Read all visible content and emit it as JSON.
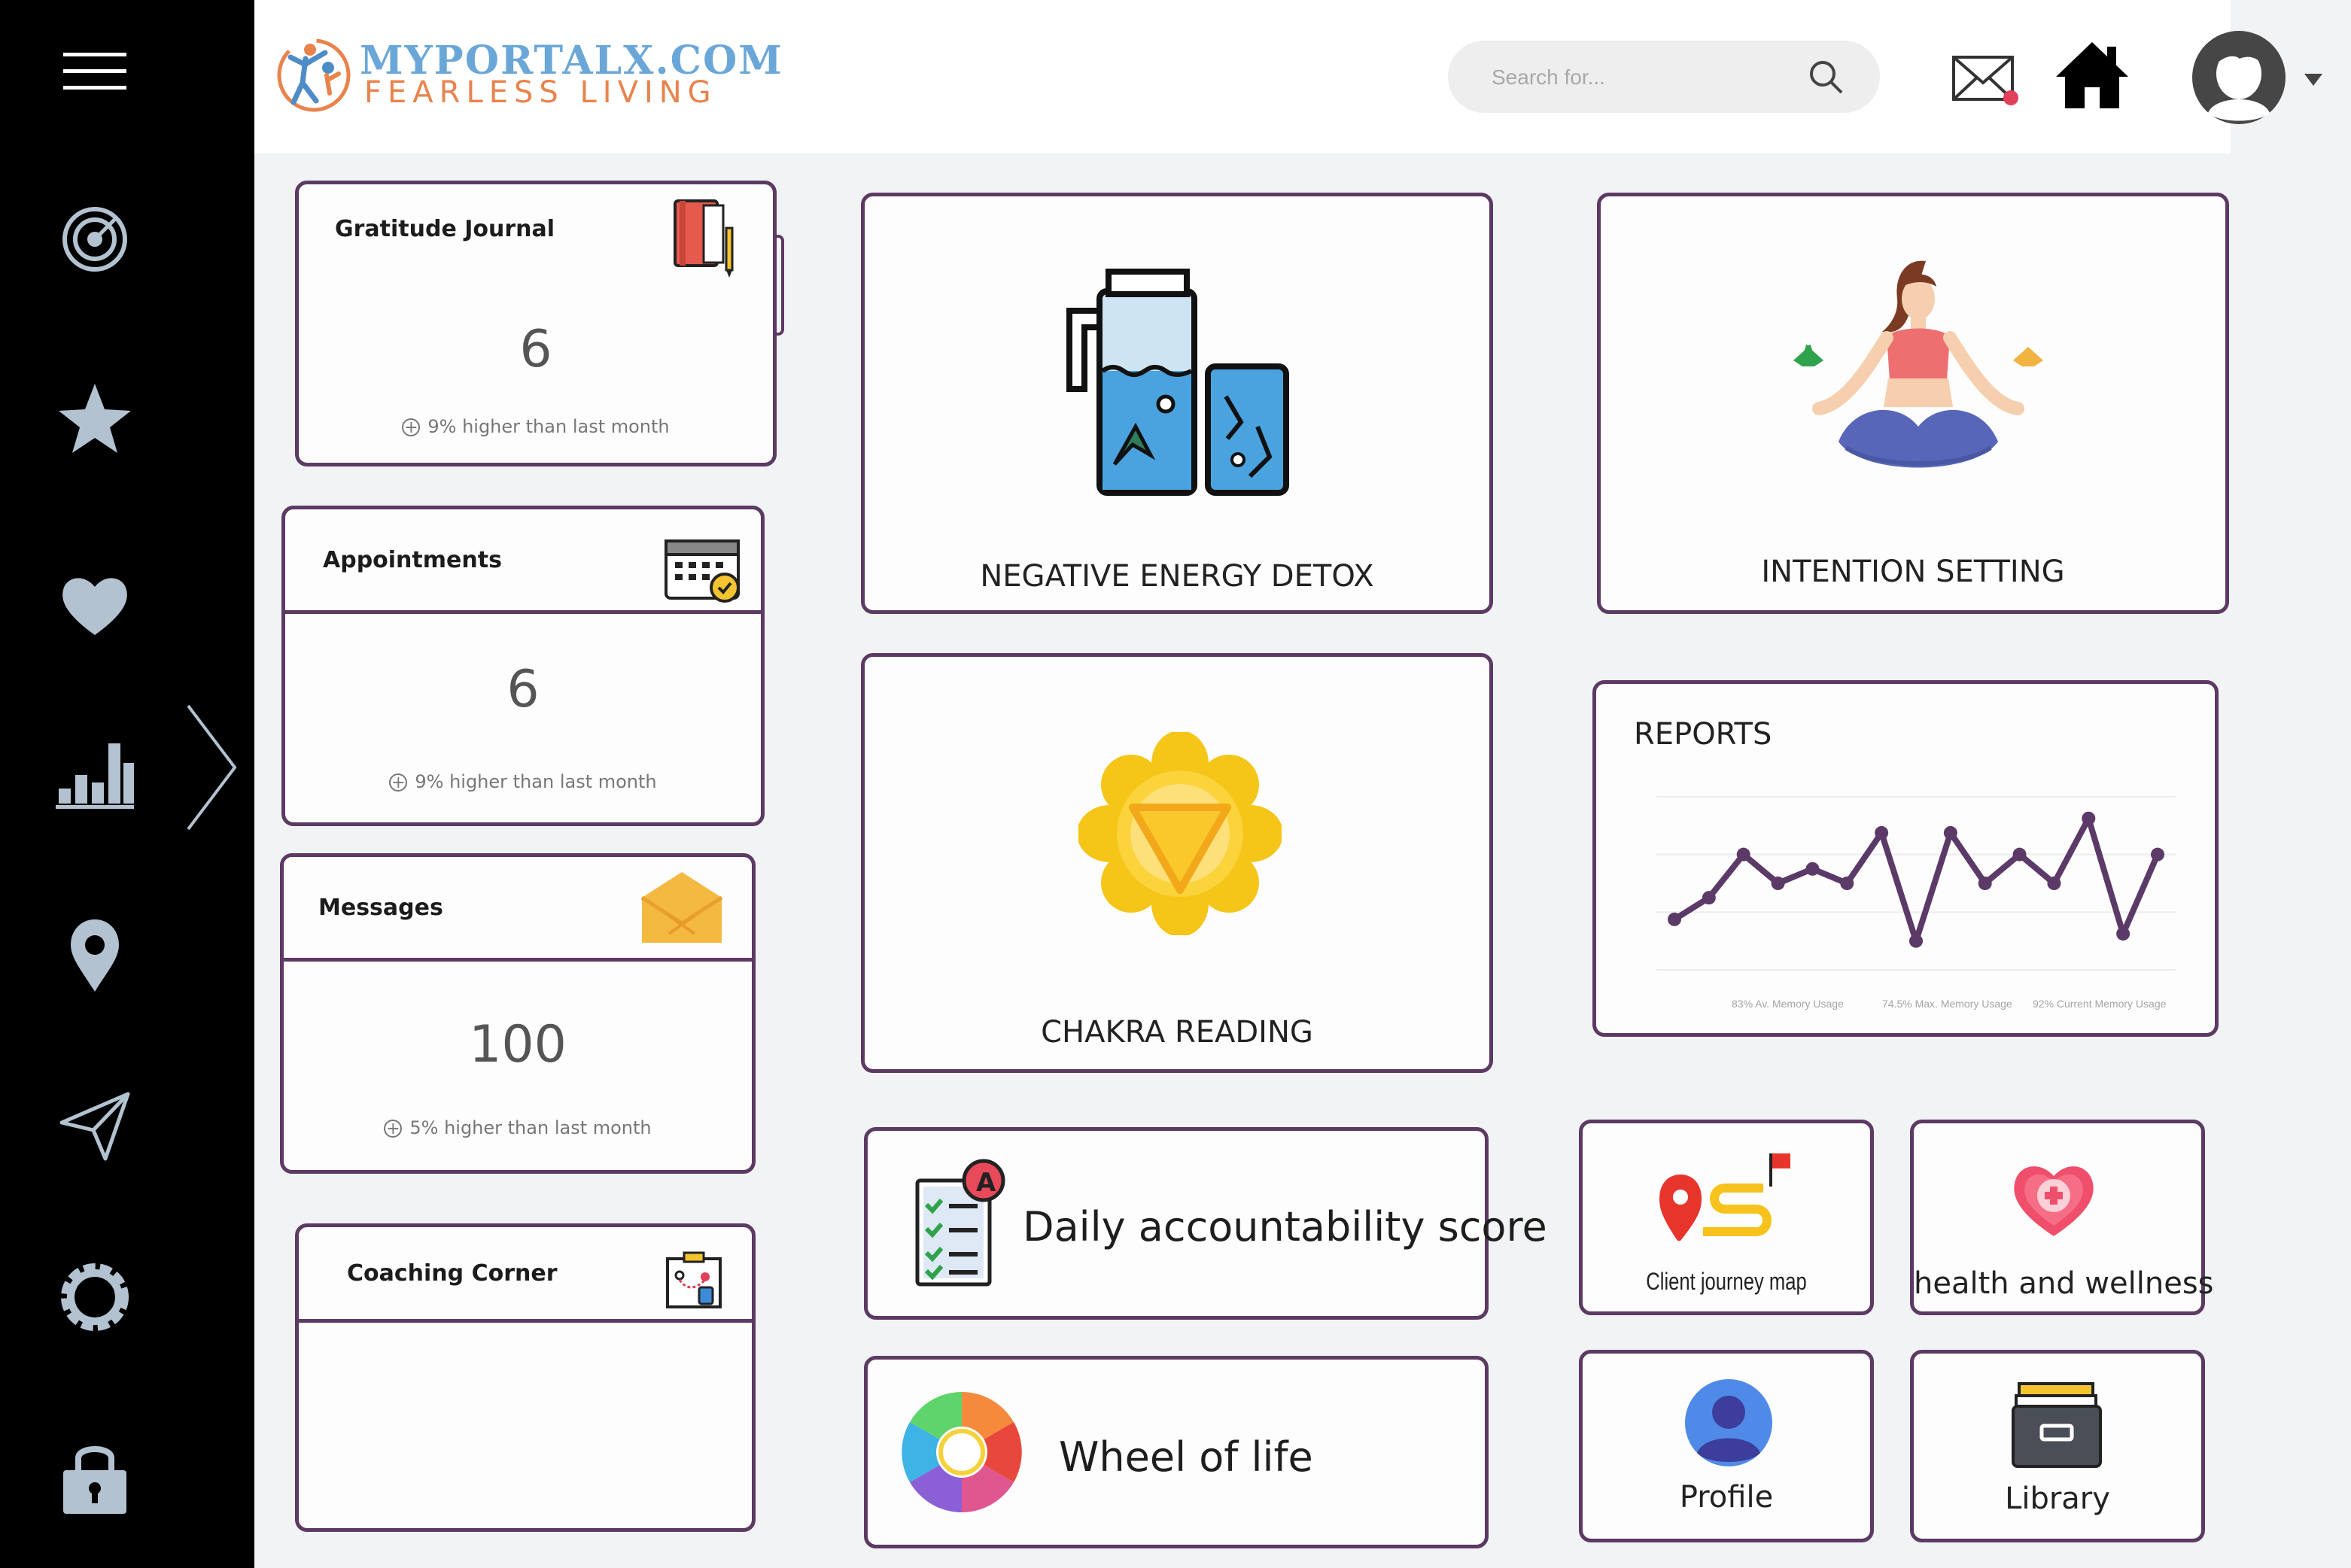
{
  "header": {
    "logo_title": "MYPORTALX.COM",
    "logo_tagline": "FEARLESS LIVING",
    "search_placeholder": "Search for...",
    "icons": [
      "mail-icon",
      "home-icon",
      "avatar",
      "chevron-down-icon"
    ]
  },
  "sidebar": {
    "icons": [
      "menu-icon",
      "target-icon",
      "star-icon",
      "heart-icon",
      "bar-chart-icon",
      "chevron-right-icon",
      "location-pin-icon",
      "send-icon",
      "gear-icon",
      "lock-icon"
    ]
  },
  "stats": {
    "gratitude": {
      "title": "Gratitude Journal",
      "value": "6",
      "note": "9% higher than last month",
      "icon": "journal-icon"
    },
    "appointments": {
      "title": "Appointments",
      "value": "6",
      "note": "9% higher than last month",
      "icon": "calendar-icon"
    },
    "messages": {
      "title": "Messages",
      "value": "100",
      "note": "5% higher than last month",
      "icon": "envelope-icon"
    },
    "coaching": {
      "title": "Coaching Corner",
      "icon": "strategy-board-icon"
    }
  },
  "tiles": {
    "detox": {
      "label": "NEGATIVE ENERGY DETOX",
      "icon": "detox-water-icon"
    },
    "intention": {
      "label": "INTENTION SETTING",
      "icon": "meditation-icon"
    },
    "chakra": {
      "label": "CHAKRA READING",
      "icon": "chakra-icon"
    },
    "accountability": {
      "label": "Daily accountability score",
      "icon": "checklist-icon"
    },
    "wheel": {
      "label": "Wheel of life",
      "icon": "color-wheel-icon"
    },
    "journey": {
      "label": "Client journey map",
      "icon": "journey-map-icon"
    },
    "health": {
      "label": "health and wellness",
      "icon": "heart-plus-icon"
    },
    "profile": {
      "label": "Profile",
      "icon": "user-icon"
    },
    "library": {
      "label": "Library",
      "icon": "folder-box-icon"
    }
  },
  "reports": {
    "title": "REPORTS",
    "chart_data": {
      "type": "line",
      "y": [
        7,
        10,
        16,
        12,
        14,
        12,
        19,
        4,
        19,
        12,
        16,
        12,
        21,
        5,
        16
      ],
      "tick_labels": [
        "83% Av. Memory Usage",
        "74.5% Max. Memory Usage",
        "92% Current Memory Usage"
      ],
      "color": "#5b3a68",
      "grid": true
    }
  },
  "colors": {
    "accent": "#5c3a63",
    "sidebar": "#000000",
    "icon_gray": "#b3c2d0"
  }
}
